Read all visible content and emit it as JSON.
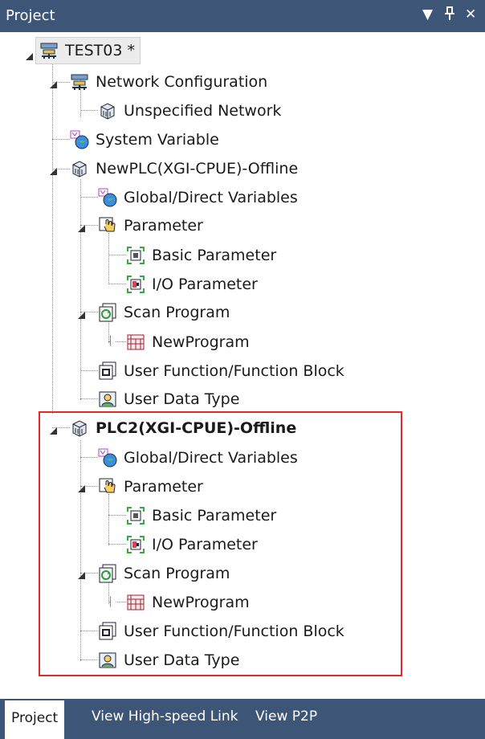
{
  "panel": {
    "title": "Project",
    "controls": {
      "dropdown_icon": "chevron-down-icon",
      "pin_icon": "pin-icon",
      "close_icon": "close-icon"
    }
  },
  "tree": {
    "root": "TEST03 *",
    "network_configuration": "Network Configuration",
    "unspecified_network": "Unspecified Network",
    "system_variable": "System Variable",
    "plc1": {
      "name": "NewPLC(XGI-CPUE)-Offline",
      "global_vars": "Global/Direct Variables",
      "parameter": "Parameter",
      "basic_parameter": "Basic Parameter",
      "io_parameter": "I/O Parameter",
      "scan_program": "Scan Program",
      "new_program": "NewProgram",
      "user_function": "User Function/Function Block",
      "user_data_type": "User Data Type"
    },
    "plc2": {
      "name": "PLC2(XGI-CPUE)-Offline",
      "global_vars": "Global/Direct Variables",
      "parameter": "Parameter",
      "basic_parameter": "Basic Parameter",
      "io_parameter": "I/O Parameter",
      "scan_program": "Scan Program",
      "new_program": "NewProgram",
      "user_function": "User Function/Function Block",
      "user_data_type": "User Data Type"
    }
  },
  "tabs": [
    "Project",
    "View High-speed Link",
    "View P2P"
  ],
  "colors": {
    "panel_header": "#3d5577",
    "highlight": "#e22a2a"
  }
}
